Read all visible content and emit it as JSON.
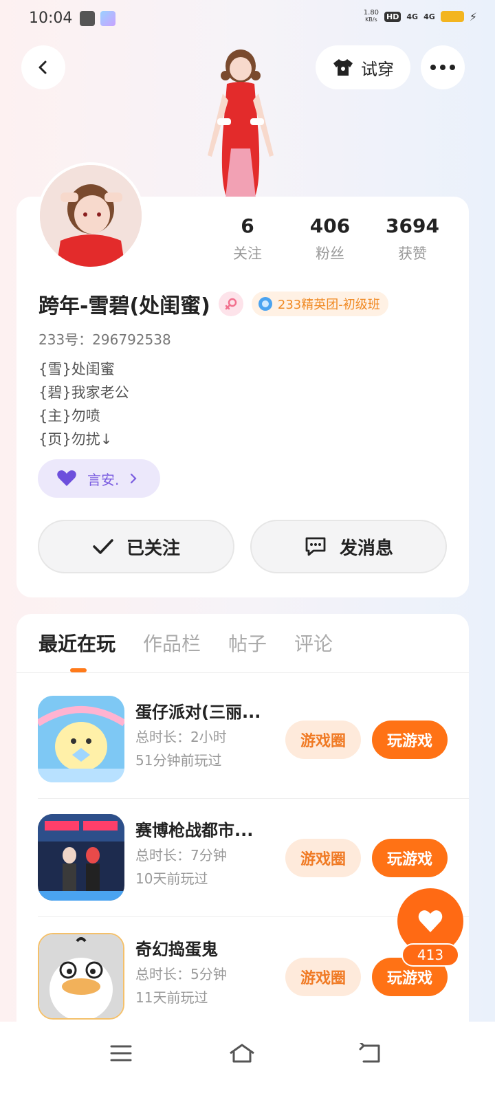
{
  "status_bar": {
    "time": "10:04",
    "net_speed_value": "1.80",
    "net_speed_unit": "KB/s",
    "hd_label": "HD",
    "signal1": "4G",
    "signal2": "4G"
  },
  "header": {
    "try_on_label": "试穿"
  },
  "profile": {
    "stats": [
      {
        "value": "6",
        "label": "关注"
      },
      {
        "value": "406",
        "label": "粉丝"
      },
      {
        "value": "3694",
        "label": "获赞"
      }
    ],
    "name": "跨年-雪碧(处闺蜜)",
    "level_badge": "233精英团-初级班",
    "uid": "233号：296792538",
    "bio_lines": [
      "{雪}处闺蜜",
      "{碧}我家老公",
      "{主}勿喷",
      "{页}勿扰↓"
    ],
    "partner_name": "言安.",
    "follow_label": "已关注",
    "message_label": "发消息"
  },
  "tabs": [
    "最近在玩",
    "作品栏",
    "帖子",
    "评论"
  ],
  "games": [
    {
      "title": "蛋仔派对(三丽...",
      "duration": "总时长：2小时",
      "last_played": "51分钟前玩过",
      "circle_label": "游戏圈",
      "play_label": "玩游戏"
    },
    {
      "title": "赛博枪战都市...",
      "duration": "总时长：7分钟",
      "last_played": "10天前玩过",
      "circle_label": "游戏圈",
      "play_label": "玩游戏"
    },
    {
      "title": "奇幻捣蛋鬼",
      "duration": "总时长：5分钟",
      "last_played": "11天前玩过",
      "circle_label": "游戏圈",
      "play_label": "玩游戏"
    }
  ],
  "like": {
    "count": "413"
  },
  "colors": {
    "accent": "#ff7215",
    "accent_light": "#feeadb",
    "partner": "#7a5ce0"
  }
}
